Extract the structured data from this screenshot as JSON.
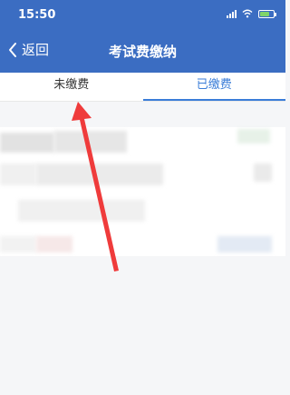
{
  "status": {
    "time": "15:50"
  },
  "nav": {
    "back_label": "返回",
    "title": "考试费缴纳"
  },
  "tabs": [
    {
      "label": "未缴费",
      "active": false
    },
    {
      "label": "已缴费",
      "active": true
    }
  ],
  "colors": {
    "header": "#3b6dc2",
    "accent": "#3b7dd8",
    "arrow": "#ef3b3b"
  }
}
